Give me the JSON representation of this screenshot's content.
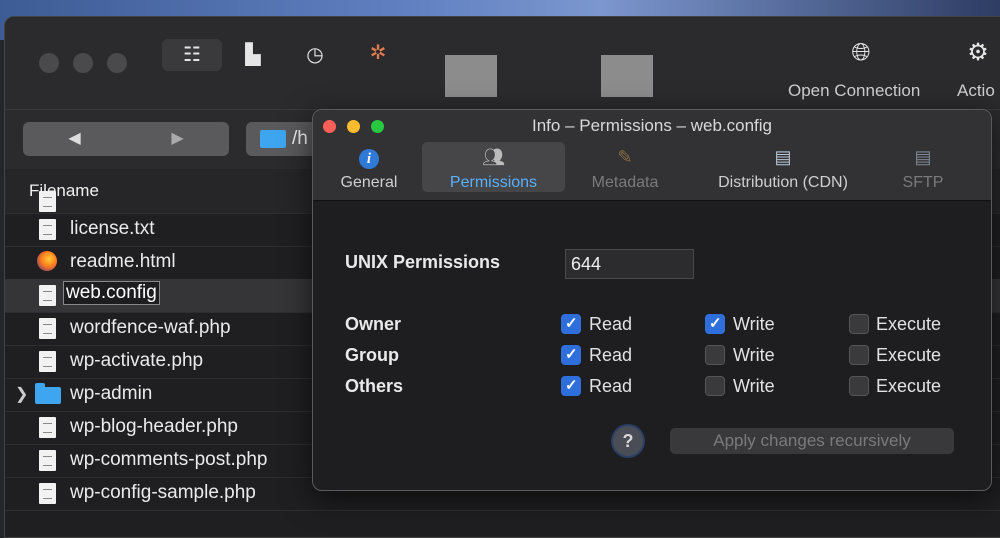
{
  "toolbar": {
    "open_connection_label": "Open Connection",
    "action_label": "Actio"
  },
  "navbar": {
    "back_glyph": "◀",
    "forward_glyph": "▶",
    "path_text": "/h"
  },
  "browser": {
    "column_header": "Filename",
    "files": [
      {
        "name": "license.txt",
        "icon": "document-icon",
        "selected": false
      },
      {
        "name": "readme.html",
        "icon": "firefox-icon",
        "selected": false
      },
      {
        "name": "web.config",
        "icon": "document-icon",
        "selected": true
      },
      {
        "name": "wordfence-waf.php",
        "icon": "document-icon",
        "selected": false
      },
      {
        "name": "wp-activate.php",
        "icon": "document-icon",
        "selected": false
      },
      {
        "name": "wp-admin",
        "icon": "folder-icon",
        "selected": false
      },
      {
        "name": "wp-blog-header.php",
        "icon": "document-icon",
        "selected": false
      },
      {
        "name": "wp-comments-post.php",
        "icon": "document-icon",
        "selected": false
      },
      {
        "name": "wp-config-sample.php",
        "icon": "document-icon",
        "selected": false
      }
    ]
  },
  "info": {
    "title": "Info – Permissions – web.config",
    "tabs": [
      {
        "label": "General",
        "icon": "info-icon",
        "active": false,
        "enabled": true
      },
      {
        "label": "Permissions",
        "icon": "users-icon",
        "active": true,
        "enabled": true
      },
      {
        "label": "Metadata",
        "icon": "pencil-icon",
        "active": false,
        "enabled": false
      },
      {
        "label": "Distribution (CDN)",
        "icon": "server-icon",
        "active": false,
        "enabled": true
      },
      {
        "label": "SFTP",
        "icon": "server-icon",
        "active": false,
        "enabled": false
      }
    ],
    "unix_label": "UNIX Permissions",
    "unix_value": "644",
    "rows": [
      {
        "label": "Owner",
        "read": true,
        "write": true,
        "execute": false
      },
      {
        "label": "Group",
        "read": true,
        "write": false,
        "execute": false
      },
      {
        "label": "Others",
        "read": true,
        "write": false,
        "execute": false
      }
    ],
    "col_labels": {
      "read": "Read",
      "write": "Write",
      "execute": "Execute"
    },
    "help_glyph": "?",
    "apply_label": "Apply changes recursively"
  },
  "colors": {
    "accent": "#2f6fdc",
    "close": "#fe5f57",
    "minimize": "#febc2e",
    "zoom": "#28c840"
  }
}
